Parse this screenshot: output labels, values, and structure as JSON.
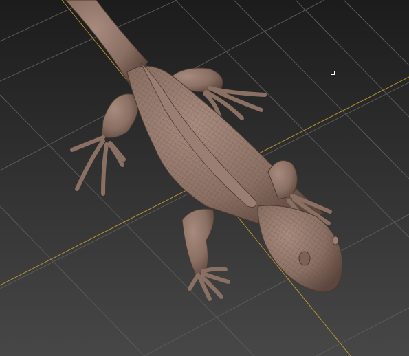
{
  "viewport": {
    "label": "",
    "background_top": "#1c1c1c",
    "background_bottom": "#474747",
    "grid_color": "#5a5a5a",
    "axis_color": "#b8942e",
    "model": "lizard",
    "mesh_color": "#8a6f63",
    "wire_color": "#5d4a41"
  }
}
